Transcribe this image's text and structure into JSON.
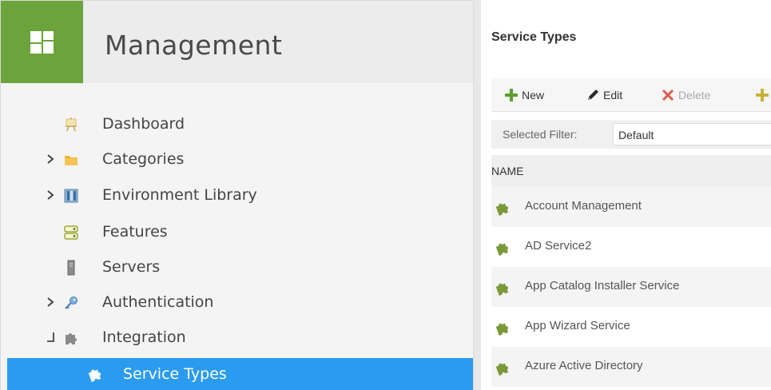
{
  "sidebar": {
    "title": "Management",
    "items": [
      {
        "label": "Dashboard",
        "icon": "dashboard-easel-icon",
        "expandable": false
      },
      {
        "label": "Categories",
        "icon": "folder-icon",
        "expandable": true
      },
      {
        "label": "Environment Library",
        "icon": "environment-library-icon",
        "expandable": true
      },
      {
        "label": "Features",
        "icon": "features-icon",
        "expandable": false
      },
      {
        "label": "Servers",
        "icon": "server-icon",
        "expandable": false
      },
      {
        "label": "Authentication",
        "icon": "key-icon",
        "expandable": true
      },
      {
        "label": "Integration",
        "icon": "puzzle-icon",
        "expandable": true,
        "expanded": true
      },
      {
        "label": "Service Types",
        "icon": "puzzle-icon",
        "selected": true
      }
    ]
  },
  "main": {
    "title": "Service Types",
    "toolbar": {
      "new_label": "New",
      "edit_label": "Edit",
      "delete_label": "Delete"
    },
    "filter": {
      "label": "Selected Filter:",
      "value": "Default"
    },
    "table": {
      "header": "NAME",
      "rows": [
        "Account Management",
        "AD Service2",
        "App Catalog Installer Service",
        "App Wizard Service",
        "Azure Active Directory"
      ]
    }
  },
  "colors": {
    "brand_green": "#6aa43a",
    "selection_blue": "#2b9bf0",
    "delete_red": "#e05a4a",
    "add_green": "#5a9e2f"
  }
}
